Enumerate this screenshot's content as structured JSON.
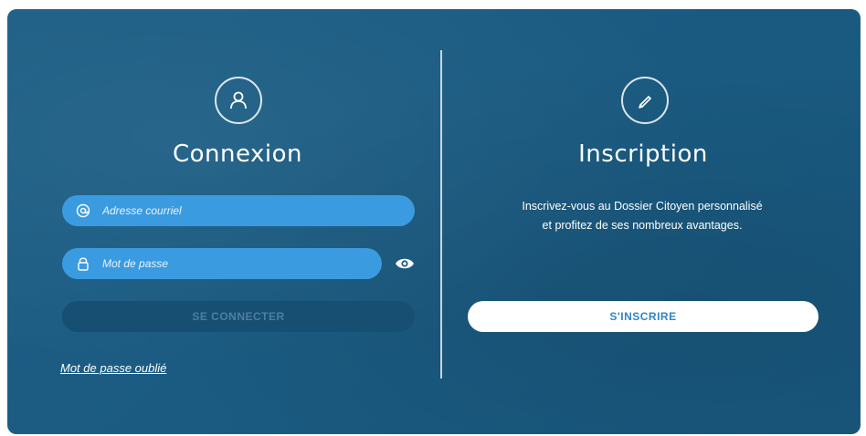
{
  "login": {
    "title": "Connexion",
    "email_placeholder": "Adresse courriel",
    "password_placeholder": "Mot de passe",
    "submit_label": "SE CONNECTER",
    "forgot_password": "Mot de passe oublié",
    "icon": "user-icon",
    "email_icon": "at-icon",
    "password_icon": "lock-icon",
    "toggle_icon": "eye-icon"
  },
  "register": {
    "title": "Inscription",
    "description": "Inscrivez-vous au Dossier Citoyen personnalisé et profitez de ses nombreux avantages.",
    "button_label": "S'INSCRIRE",
    "icon": "pencil-icon"
  },
  "colors": {
    "panel_background": "#1b5b82",
    "input_background": "#3b9be0",
    "disabled_button": "#174f72",
    "register_text": "#2e86c8"
  }
}
